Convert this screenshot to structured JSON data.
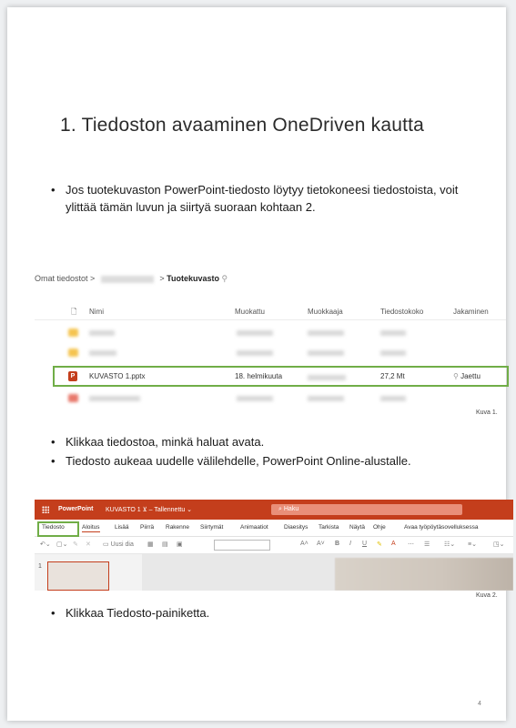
{
  "title": "1. Tiedoston avaaminen OneDriven kautta",
  "bullet1": "Jos tuotekuvaston PowerPoint-tiedosto löytyy tietokoneesi tiedostoista, voit ylittää tämän luvun ja siirtyä suoraan kohtaan 2.",
  "onedrive": {
    "breadcrumb_root": "Omat tiedostot",
    "breadcrumb_sep": ">",
    "breadcrumb_current": "Tuotekuvasto",
    "columns": {
      "name": "Nimi",
      "modified": "Muokattu",
      "modified_by": "Muokkaaja",
      "size": "Tiedostokoko",
      "sharing": "Jakaminen"
    },
    "file": {
      "name": "KUVASTO 1.pptx",
      "modified": "18. helmikuuta",
      "size": "27,2 Mt",
      "sharing": "Jaettu"
    },
    "caption": "Kuva 1."
  },
  "bullets2": [
    "Klikkaa tiedostoa, minkä haluat avata.",
    "Tiedosto aukeaa uudelle välilehdelle, PowerPoint Online-alustalle."
  ],
  "ppt": {
    "app": "PowerPoint",
    "doc": "KUVASTO 1 ⊻ – Tallennettu ⌄",
    "search": "Haku",
    "tabs": [
      "Tiedosto",
      "Aloitus",
      "Lisää",
      "Piirrä",
      "Rakenne",
      "Siirtymät",
      "Animaatiot",
      "Diaesitys",
      "Tarkista",
      "Näytä",
      "Ohje",
      "Avaa työpöytäsovelluksessa"
    ],
    "new_slide": "Uusi dia",
    "slide_number": "1",
    "caption": "Kuva 2."
  },
  "bullet3": "Klikkaa Tiedosto-painiketta.",
  "page_number": "4",
  "colors": {
    "accent_green": "#70ad47",
    "ppt_red": "#c43e1c"
  }
}
